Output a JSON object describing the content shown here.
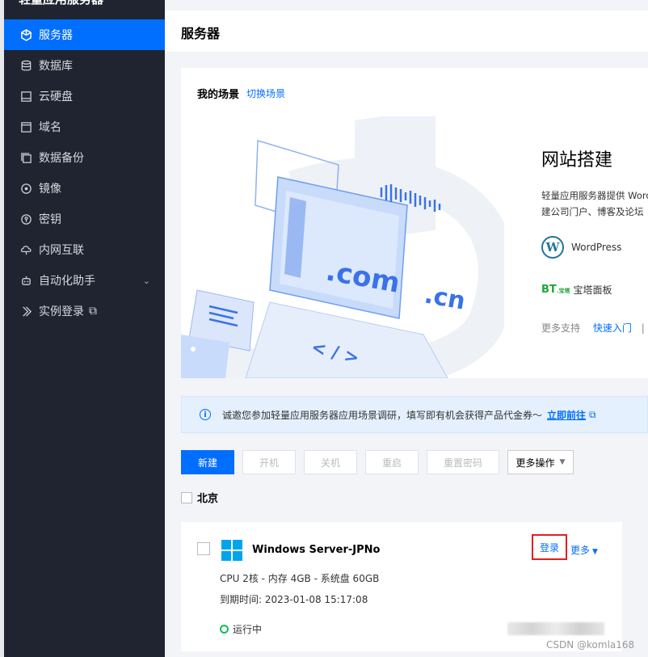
{
  "sidebar": {
    "top_title": "轻量应用服务器",
    "items": [
      {
        "label": "服务器",
        "icon": "cube-icon",
        "active": true
      },
      {
        "label": "数据库",
        "icon": "database-icon"
      },
      {
        "label": "云硬盘",
        "icon": "disk-icon"
      },
      {
        "label": "域名",
        "icon": "domain-icon"
      },
      {
        "label": "数据备份",
        "icon": "backup-icon"
      },
      {
        "label": "镜像",
        "icon": "image-icon"
      },
      {
        "label": "密钥",
        "icon": "key-icon"
      },
      {
        "label": "内网互联",
        "icon": "network-icon"
      },
      {
        "label": "自动化助手",
        "icon": "automation-icon",
        "chevron": "⌄"
      },
      {
        "label": "实例登录",
        "icon": "login-icon",
        "external": "⧉"
      }
    ]
  },
  "header": {
    "title": "服务器"
  },
  "scene": {
    "title": "我的场景",
    "switch_label": "切换场景",
    "art_text": {
      "com": ".com",
      "cn": ".cn",
      "code": "< / >"
    },
    "site_title": "网站搭建",
    "desc_line1": "轻量应用服务器提供 WordPress",
    "desc_line2": "建公司门户、博客及论坛",
    "wordpress_label": "WordPress",
    "wp_logo_letter": "W",
    "bt_logo": "BT",
    "bt_logo_small": ".宝塔",
    "bt_label": "宝塔面板",
    "support_label": "更多支持",
    "quickstart_label": "快速入门",
    "separator": "|"
  },
  "notice": {
    "icon_glyph": "i",
    "text": "诚邀您参加轻量应用服务器应用场景调研，填写即有机会获得产品代金券～",
    "link": "立即前往",
    "external": "⧉"
  },
  "toolbar": {
    "new": "新建",
    "start": "开机",
    "stop": "关机",
    "restart": "重启",
    "reset_password": "重置密码",
    "more_actions": "更多操作",
    "caret": "▼"
  },
  "region": {
    "label": "北京"
  },
  "instance": {
    "name": "Windows Server-JPNo",
    "login": "登录",
    "more": "更多",
    "caret": "▼",
    "spec": "CPU 2核 - 内存 4GB - 系统盘 60GB",
    "expiry_label": "到期时间:",
    "expiry_value": "2023-01-08 15:17:08",
    "status": "运行中",
    "status_color": "#0abf5b"
  },
  "watermark": "CSDN @komla168",
  "colors": {
    "accent": "#006eff",
    "sidebar_bg": "#1f2430",
    "highlight_border": "#e02020"
  }
}
